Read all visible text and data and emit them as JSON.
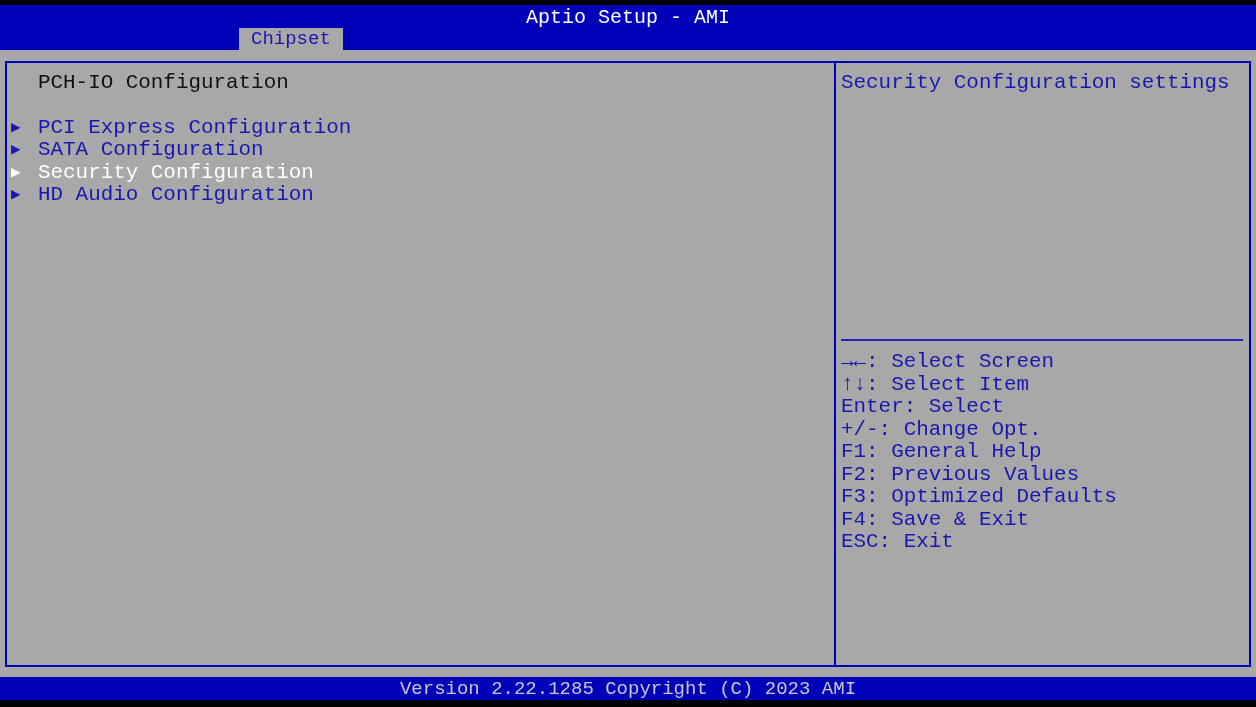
{
  "window": {
    "title": "Aptio Setup - AMI"
  },
  "tabs": [
    {
      "label": "Chipset",
      "selected": true
    }
  ],
  "main": {
    "heading": "PCH-IO Configuration",
    "items": [
      {
        "marker": "▶",
        "label": "PCI Express Configuration",
        "selected": false
      },
      {
        "marker": "▶",
        "label": "SATA Configuration",
        "selected": false
      },
      {
        "marker": "▶",
        "label": "Security Configuration",
        "selected": true
      },
      {
        "marker": "▶",
        "label": "HD Audio Configuration",
        "selected": false
      }
    ]
  },
  "help": {
    "description": "Security Configuration settings",
    "keys": [
      "→←: Select Screen",
      "↑↓: Select Item",
      "Enter: Select",
      "+/-: Change Opt.",
      "F1: General Help",
      "F2: Previous Values",
      "F3: Optimized Defaults",
      "F4: Save & Exit",
      "ESC: Exit"
    ]
  },
  "status_bar": {
    "text": "Version 2.22.1285 Copyright (C) 2023 AMI"
  }
}
